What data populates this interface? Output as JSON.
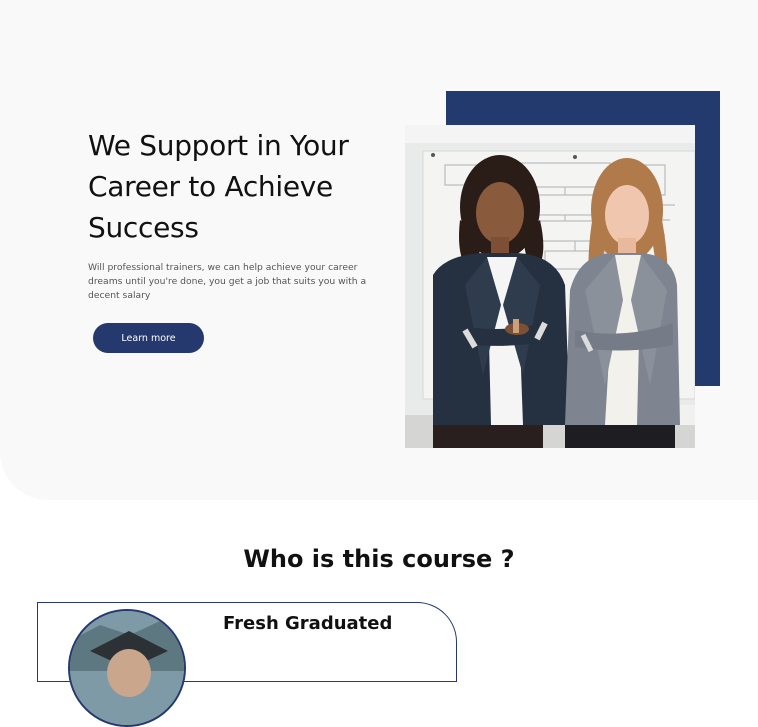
{
  "hero": {
    "title": "We Support in Your Career to Achieve Success",
    "subtitle": "Will professional trainers, we can help achieve your career dreams until you're done, you get a job that suits you with a decent salary",
    "cta_label": "Learn more",
    "accent_color": "#233a6e",
    "background_color": "#f9f9f9"
  },
  "audience": {
    "heading": "Who is this course ?",
    "cards": [
      {
        "title": "Fresh Graduated"
      }
    ]
  }
}
